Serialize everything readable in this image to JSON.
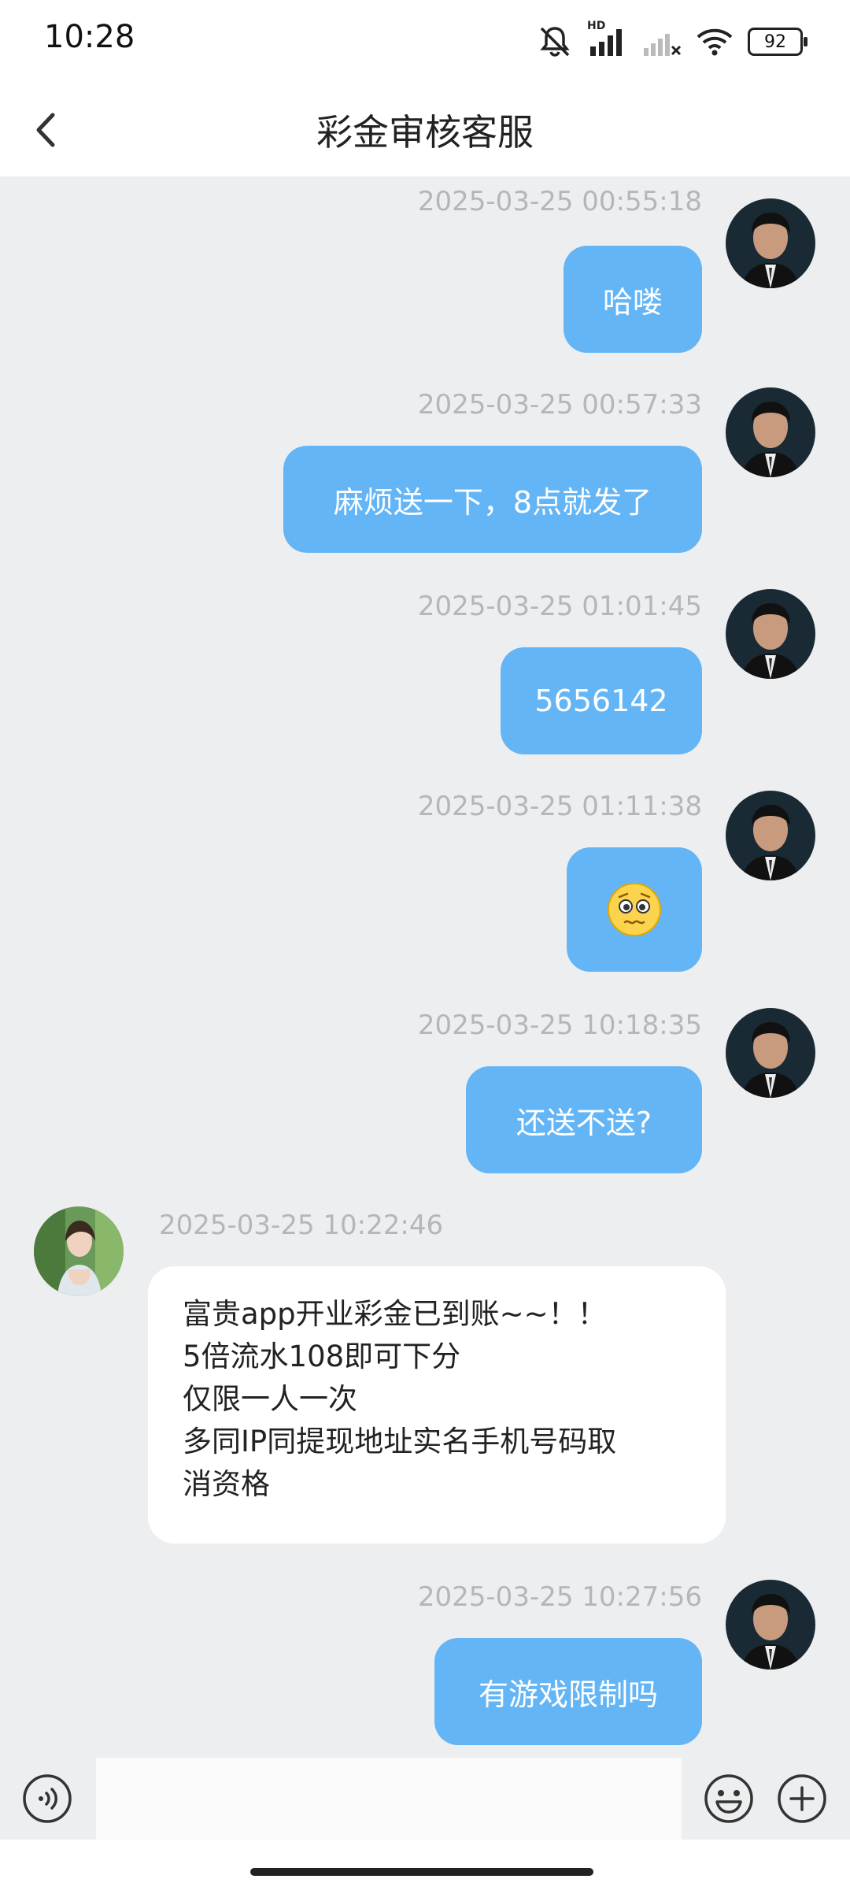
{
  "status_bar": {
    "time": "10:28",
    "battery": "92",
    "network_label": "HD"
  },
  "header": {
    "title": "彩金审核客服"
  },
  "messages": [
    {
      "side": "right",
      "time": "2025-03-25 00:55:18",
      "text": "哈喽"
    },
    {
      "side": "right",
      "time": "2025-03-25 00:57:33",
      "text": "麻烦送一下，8点就发了"
    },
    {
      "side": "right",
      "time": "2025-03-25 01:01:45",
      "text": "5656142"
    },
    {
      "side": "right",
      "time": "2025-03-25 01:11:38",
      "text": "",
      "icon": "pleading-face-emoji"
    },
    {
      "side": "right",
      "time": "2025-03-25 10:18:35",
      "text": "还送不送?"
    },
    {
      "side": "left",
      "time": "2025-03-25 10:22:46",
      "lines": [
        "富贵app开业彩金已到账~~！！",
        " 5倍流水108即可下分",
        "仅限一人一次",
        "多同IP同提现地址实名手机号码取",
        "消资格"
      ]
    },
    {
      "side": "right",
      "time": "2025-03-25 10:27:56",
      "text": "有游戏限制吗"
    }
  ],
  "input": {
    "placeholder": ""
  },
  "colors": {
    "bubble_sent": "#64b5f6",
    "chat_bg": "#edeef0",
    "bubble_received": "#ffffff"
  },
  "icons": {
    "voice": "voice-icon",
    "emoji": "emoji-icon",
    "plus": "plus-icon",
    "back": "back-arrow-icon"
  }
}
